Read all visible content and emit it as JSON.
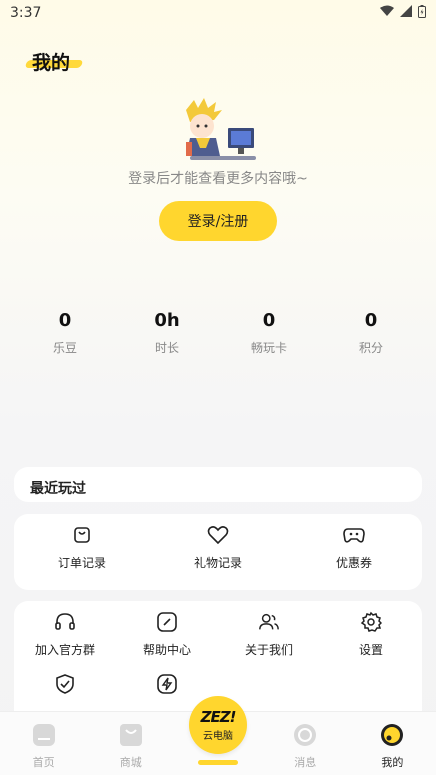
{
  "status_bar": {
    "time": "3:37"
  },
  "header": {
    "title": "我的"
  },
  "login": {
    "hint": "登录后才能查看更多内容哦~",
    "button_label": "登录/注册"
  },
  "stats": [
    {
      "value": "0",
      "label": "乐豆"
    },
    {
      "value": "0h",
      "label": "时长"
    },
    {
      "value": "0",
      "label": "畅玩卡"
    },
    {
      "value": "0",
      "label": "积分"
    }
  ],
  "recent": {
    "title": "最近玩过"
  },
  "orders": [
    {
      "label": "订单记录",
      "icon": "bag-icon"
    },
    {
      "label": "礼物记录",
      "icon": "heart-icon"
    },
    {
      "label": "优惠券",
      "icon": "gamepad-icon"
    }
  ],
  "services": [
    {
      "label": "加入官方群",
      "icon": "headset-icon"
    },
    {
      "label": "帮助中心",
      "icon": "pencil-icon"
    },
    {
      "label": "关于我们",
      "icon": "users-icon"
    },
    {
      "label": "设置",
      "icon": "gear-icon"
    },
    {
      "label": "",
      "icon": "shield-check-icon"
    },
    {
      "label": "",
      "icon": "lightning-icon"
    }
  ],
  "bottom_nav": {
    "items": [
      {
        "label": "首页",
        "icon": "home-icon"
      },
      {
        "label": "商城",
        "icon": "store-icon"
      },
      {
        "label": "云电脑",
        "logo": "ZEZ!",
        "icon": "cloud-pc-icon"
      },
      {
        "label": "消息",
        "icon": "message-icon"
      },
      {
        "label": "我的",
        "icon": "profile-icon",
        "active": true
      }
    ]
  },
  "colors": {
    "accent": "#ffd62e"
  }
}
